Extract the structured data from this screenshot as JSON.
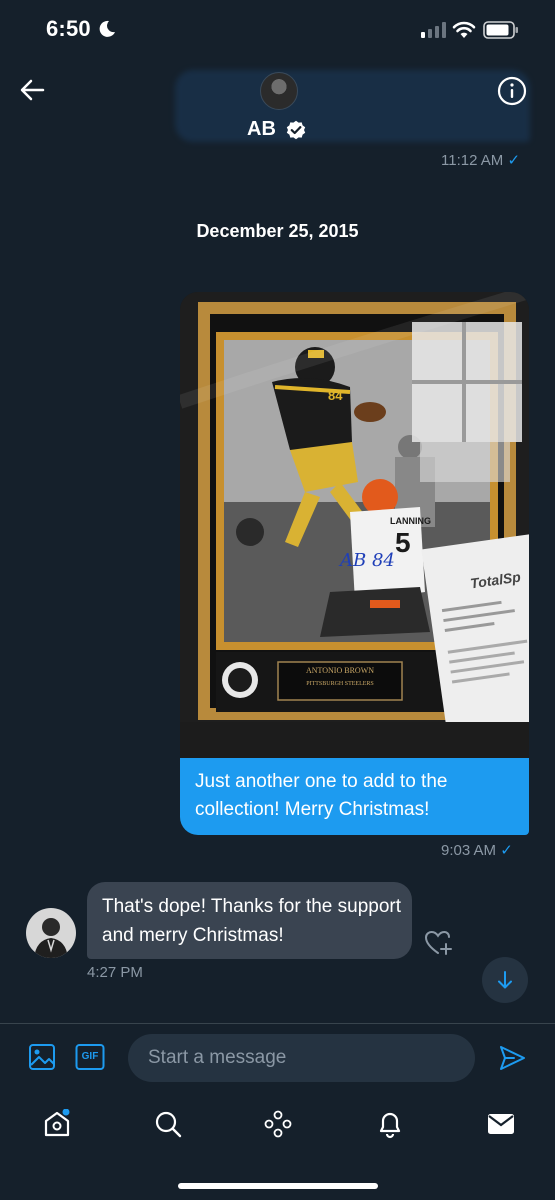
{
  "status_bar": {
    "time": "6:50",
    "icons": [
      "moon-icon",
      "signal-icon",
      "wifi-icon",
      "battery-icon"
    ]
  },
  "header": {
    "name": "AB",
    "icons": [
      "back-arrow-icon",
      "verified-badge-icon",
      "info-icon"
    ]
  },
  "messages": {
    "prev_time": "11:12 AM",
    "date_separator": "December 25, 2015",
    "outgoing": {
      "text": "Just another one to add to the collection! Merry Christmas!",
      "time": "9:03 AM",
      "photo": {
        "jersey_number": "84",
        "opponent_name": "LANNING",
        "opponent_number": "5",
        "plaque_line1": "ANTONIO BROWN",
        "plaque_line2": "PITTSBURGH STEELERS",
        "receipt_brand": "TotalSp",
        "signature": "AB 84"
      }
    },
    "incoming": {
      "text": "That's dope! Thanks for the support and merry Christmas!",
      "time": "4:27 PM"
    }
  },
  "composer": {
    "placeholder": "Start a message",
    "gif_label": "GIF"
  },
  "tabs": [
    "home-icon",
    "search-icon",
    "spaces-icon",
    "notifications-icon",
    "messages-icon"
  ],
  "colors": {
    "background": "#15202b",
    "accent": "#1d9bf0",
    "incoming_bubble": "#3a4451",
    "muted_text": "#8b98a5"
  }
}
